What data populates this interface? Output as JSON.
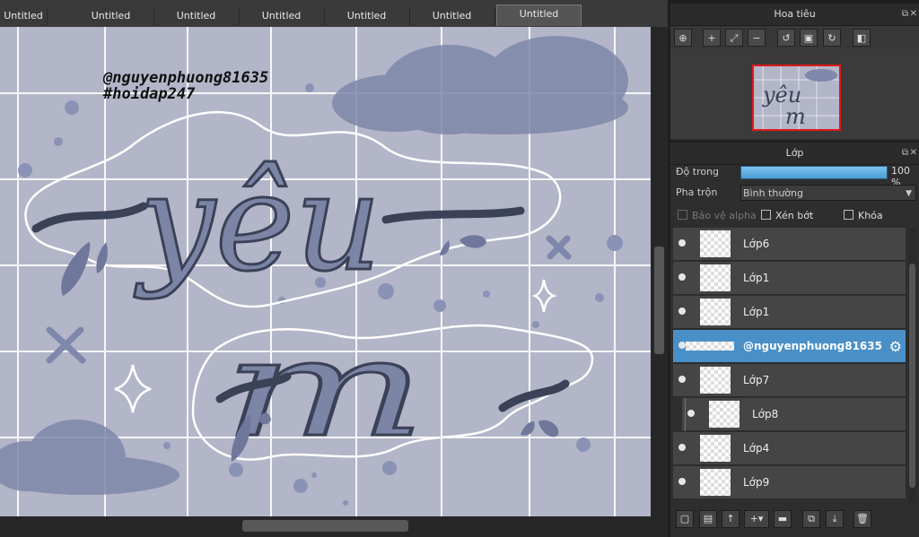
{
  "tabs": [
    {
      "label": "Untitled"
    },
    {
      "label": "Untitled"
    },
    {
      "label": "Untitled"
    },
    {
      "label": "Untitled"
    },
    {
      "label": "Untitled"
    },
    {
      "label": "Untitled"
    },
    {
      "label": "Untitled"
    }
  ],
  "active_tab": 6,
  "canvas": {
    "background_color": "#b3b5c8",
    "grid_color": "#ffffff",
    "ink_color": "#3b4257",
    "accent_color": "#7c85a6",
    "watermark_line1": "@nguyenphuong81635",
    "watermark_line2": "#hoidap247",
    "lettering_word1": "yêu",
    "lettering_word2": "m"
  },
  "navigator": {
    "title": "Hoa tiêu",
    "tools": [
      "zoom-fit-icon",
      "zoom-in-icon",
      "fit-screen-icon",
      "zoom-out-icon",
      "rotate-left-icon",
      "actual-size-icon",
      "rotate-right-icon",
      "flip-icon"
    ],
    "viewport_color": "#e01818"
  },
  "layers_panel": {
    "title": "Lớp",
    "opacity_label": "Độ trong",
    "opacity_value": "100 %",
    "opacity_fraction": 1.0,
    "blend_label": "Pha trộn",
    "blend_value": "Bình thường",
    "protect_alpha_label": "Bảo vệ alpha",
    "clipping_label": "Xén bớt",
    "lock_label": "Khóa",
    "layers": [
      {
        "name": "Lớp6",
        "selected": false,
        "indented": false
      },
      {
        "name": "Lớp1",
        "selected": false,
        "indented": false
      },
      {
        "name": "Lớp1",
        "selected": false,
        "indented": false
      },
      {
        "name": "@nguyenphuong81635",
        "selected": true,
        "indented": false
      },
      {
        "name": "Lớp7",
        "selected": false,
        "indented": false
      },
      {
        "name": "Lớp8",
        "selected": false,
        "indented": true
      },
      {
        "name": "Lớp4",
        "selected": false,
        "indented": false
      },
      {
        "name": "Lớp9",
        "selected": false,
        "indented": false
      }
    ],
    "selected_color": "#4a90c8",
    "toolbar": [
      "new-layer-icon",
      "new-layer-copy-icon",
      "import-layer-icon",
      "add-layer-dropdown-icon",
      "folder-icon",
      "duplicate-icon",
      "merge-icon",
      "delete-icon"
    ]
  }
}
